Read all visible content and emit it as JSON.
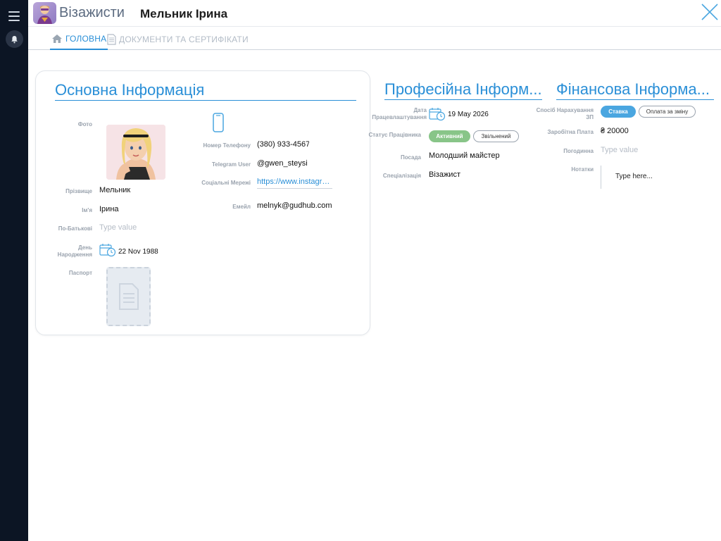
{
  "app": {
    "name": "Візажисти",
    "record_title": "Мельник Ірина"
  },
  "tabs": [
    {
      "label": "ГОЛОВНА"
    },
    {
      "label": "ДОКУМЕНТИ ТА СЕРТИФІКАТИ"
    }
  ],
  "basic": {
    "title": "Основна Інформація",
    "photo_label": "Фото",
    "surname_label": "Прізвище",
    "surname": "Мельник",
    "name_label": "Ім'я",
    "name": "Ірина",
    "patronymic_label": "По-Батькові",
    "patronymic_placeholder": "Type value",
    "birthday_label": "День Народження",
    "birthday": "22 Nov 1988",
    "passport_label": "Паспорт",
    "phone_label": "Номер Телефону",
    "phone": "(380) 933-4567",
    "telegram_label": "Telegram User",
    "telegram": "@gwen_steysi",
    "social_label": "Соціальні Мережі",
    "social": "https://www.instagra...",
    "email_label": "Емейл",
    "email": "melnyk@gudhub.com"
  },
  "professional": {
    "title": "Професійна Інформ...",
    "hire_date_label": "Дата Працевлаштування",
    "hire_date": "19 May 2026",
    "status_label": "Статус Працівника",
    "status_active": "Активний",
    "status_fired": "Звільнений",
    "position_label": "Посада",
    "position": "Молодший майстер",
    "specialization_label": "Спеціалізація",
    "specialization": "Візажист"
  },
  "financial": {
    "title": "Фінансова Інформа...",
    "pay_method_label": "Спосіб Нарахування ЗП",
    "pay_rate": "Ставка",
    "pay_per_shift": "Оплата за зміну",
    "salary_label": "Заробітна Плата",
    "salary": "₴ 20000",
    "hourly_label": "Погодинна",
    "hourly_placeholder": "Type value",
    "notes_label": "Нотатки",
    "notes_placeholder": "Type here..."
  },
  "colors": {
    "accent": "#2a8fd7",
    "sidebar": "#0c1524",
    "active_green": "#88c588",
    "rate_blue": "#4aa6e0"
  }
}
